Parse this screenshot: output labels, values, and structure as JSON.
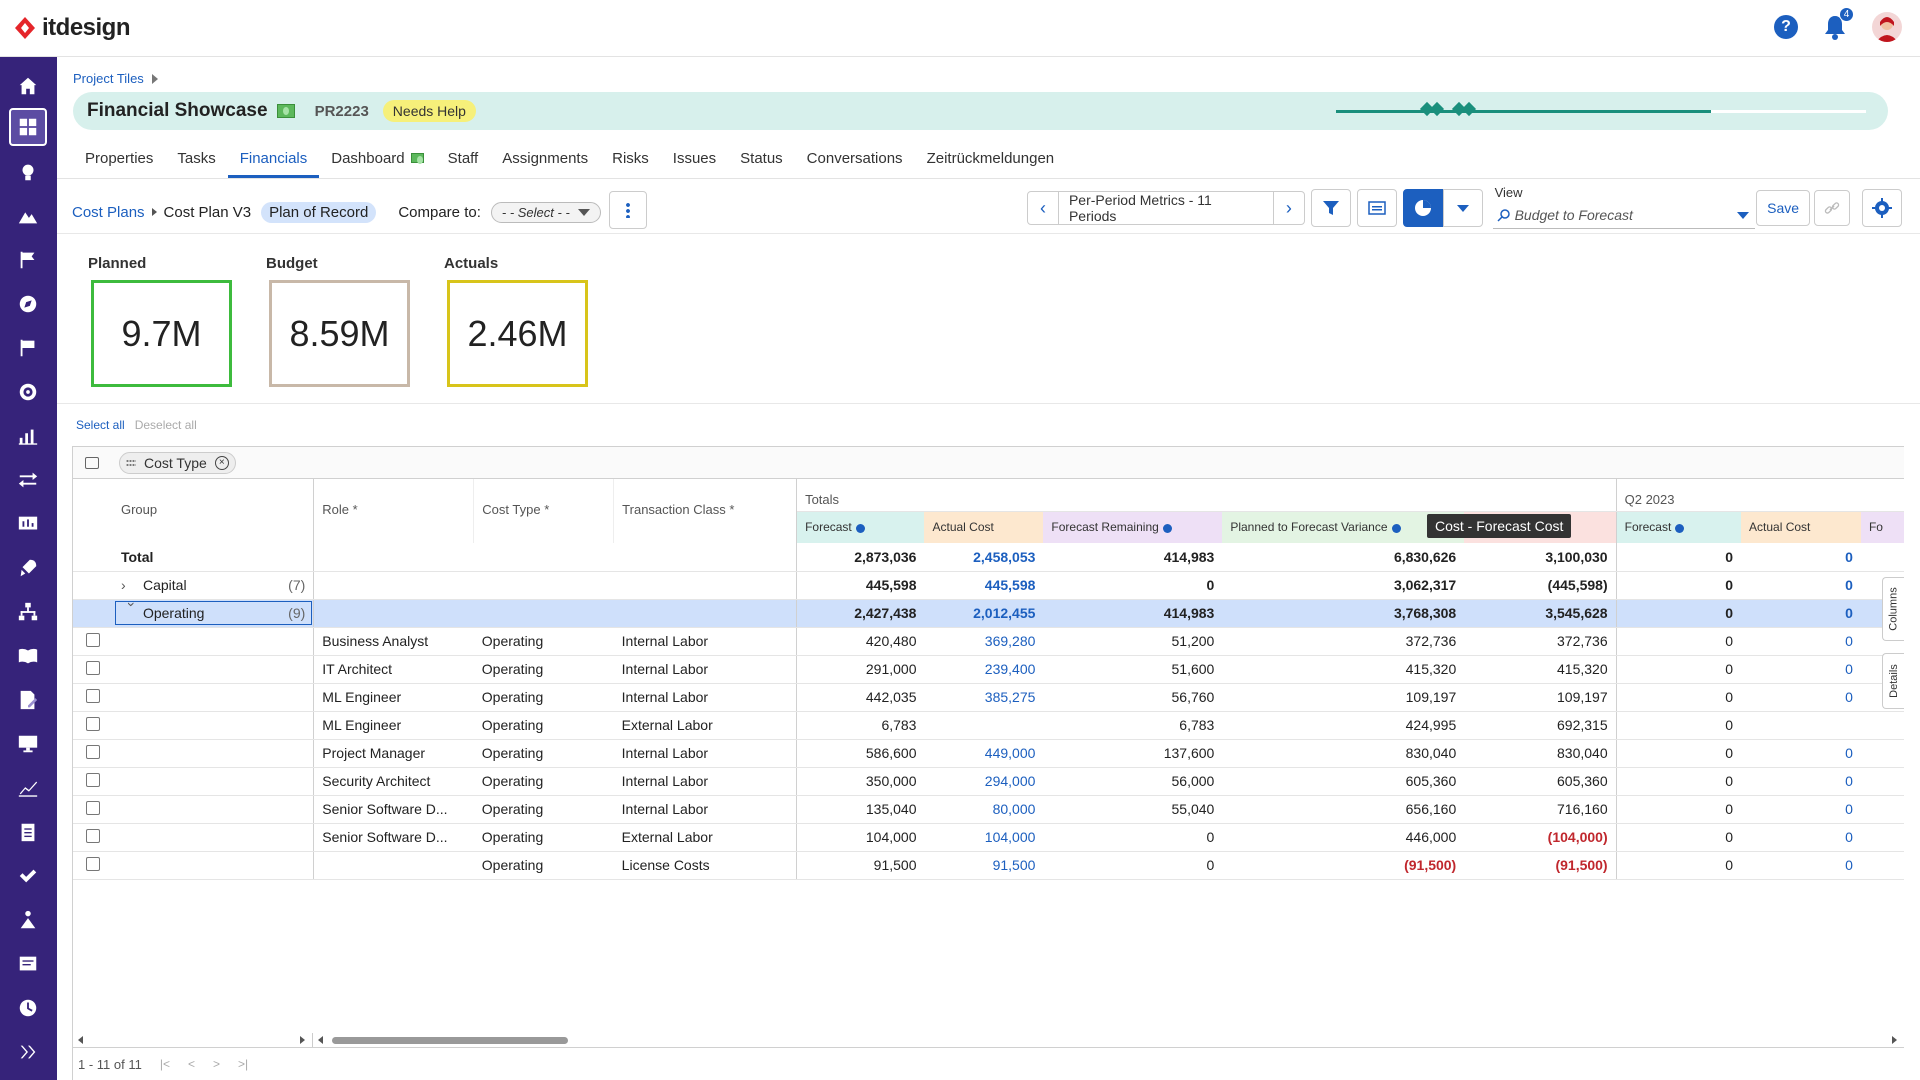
{
  "app": {
    "logo_text": "itdesign",
    "notification_count": "4"
  },
  "breadcrumb": {
    "parent": "Project Tiles"
  },
  "project": {
    "title": "Financial Showcase",
    "code": "PR2223",
    "status": "Needs Help"
  },
  "tabs": [
    "Properties",
    "Tasks",
    "Financials",
    "Dashboard",
    "Staff",
    "Assignments",
    "Risks",
    "Issues",
    "Status",
    "Conversations",
    "Zeitrückmeldungen"
  ],
  "toolbar": {
    "cost_plans": "Cost Plans",
    "cost_plan": "Cost Plan V3",
    "plan_badge": "Plan of Record",
    "compare_label": "Compare to:",
    "compare_placeholder": "- - Select - -",
    "period_label": "Per-Period Metrics - 11 Periods",
    "view_label": "View",
    "view_value": "Budget to Forecast",
    "save_label": "Save"
  },
  "kpis": [
    {
      "label": "Planned",
      "value": "9.7M",
      "color": "#3dbb3d"
    },
    {
      "label": "Budget",
      "value": "8.59M",
      "color": "#c8b8a8"
    },
    {
      "label": "Actuals",
      "value": "2.46M",
      "color": "#d8c41a"
    }
  ],
  "select_all": "Select all",
  "deselect_all": "Deselect all",
  "group_chip": "Cost Type",
  "grid": {
    "headers": {
      "group": "Group",
      "role": "Role",
      "cost_type": "Cost Type",
      "transaction_class": "Transaction Class",
      "totals": "Totals",
      "q2": "Q2 2023",
      "forecast": "Forecast",
      "actual_cost": "Actual Cost",
      "forecast_remaining": "Forecast Remaining",
      "planned_to_forecast_variance": "Planned to Forecast Variance",
      "q2_forecast": "Forecast",
      "q2_actual_cost": "Actual Cost",
      "q2_next": "Fo"
    },
    "tooltip": "Cost - Forecast Cost",
    "total_row": {
      "label": "Total",
      "forecast": "2,873,036",
      "actual": "2,458,053",
      "remaining": "414,983",
      "variance": "6,830,626",
      "cost_var": "3,100,030",
      "q2_forecast": "0",
      "q2_actual": "0"
    },
    "capital_row": {
      "label": "Capital",
      "count": "(7)",
      "forecast": "445,598",
      "actual": "445,598",
      "remaining": "0",
      "variance": "3,062,317",
      "cost_var": "(445,598)",
      "q2_forecast": "0",
      "q2_actual": "0"
    },
    "operating_row": {
      "label": "Operating",
      "count": "(9)",
      "forecast": "2,427,438",
      "actual": "2,012,455",
      "remaining": "414,983",
      "variance": "3,768,308",
      "cost_var": "3,545,628",
      "q2_forecast": "0",
      "q2_actual": "0"
    },
    "rows": [
      {
        "role": "Business Analyst",
        "cost_type": "Operating",
        "tclass": "Internal Labor",
        "forecast": "420,480",
        "actual": "369,280",
        "remaining": "51,200",
        "variance": "372,736",
        "cost_var": "372,736",
        "q2_forecast": "0",
        "q2_actual": "0"
      },
      {
        "role": "IT Architect",
        "cost_type": "Operating",
        "tclass": "Internal Labor",
        "forecast": "291,000",
        "actual": "239,400",
        "remaining": "51,600",
        "variance": "415,320",
        "cost_var": "415,320",
        "q2_forecast": "0",
        "q2_actual": "0"
      },
      {
        "role": "ML Engineer",
        "cost_type": "Operating",
        "tclass": "Internal Labor",
        "forecast": "442,035",
        "actual": "385,275",
        "remaining": "56,760",
        "variance": "109,197",
        "cost_var": "109,197",
        "q2_forecast": "0",
        "q2_actual": "0"
      },
      {
        "role": "ML Engineer",
        "cost_type": "Operating",
        "tclass": "External Labor",
        "forecast": "6,783",
        "actual": "",
        "remaining": "6,783",
        "variance": "424,995",
        "cost_var": "692,315",
        "q2_forecast": "0",
        "q2_actual": ""
      },
      {
        "role": "Project Manager",
        "cost_type": "Operating",
        "tclass": "Internal Labor",
        "forecast": "586,600",
        "actual": "449,000",
        "remaining": "137,600",
        "variance": "830,040",
        "cost_var": "830,040",
        "q2_forecast": "0",
        "q2_actual": "0"
      },
      {
        "role": "Security Architect",
        "cost_type": "Operating",
        "tclass": "Internal Labor",
        "forecast": "350,000",
        "actual": "294,000",
        "remaining": "56,000",
        "variance": "605,360",
        "cost_var": "605,360",
        "q2_forecast": "0",
        "q2_actual": "0"
      },
      {
        "role": "Senior Software D...",
        "cost_type": "Operating",
        "tclass": "Internal Labor",
        "forecast": "135,040",
        "actual": "80,000",
        "remaining": "55,040",
        "variance": "656,160",
        "cost_var": "716,160",
        "q2_forecast": "0",
        "q2_actual": "0"
      },
      {
        "role": "Senior Software D...",
        "cost_type": "Operating",
        "tclass": "External Labor",
        "forecast": "104,000",
        "actual": "104,000",
        "remaining": "0",
        "variance": "446,000",
        "cost_var": "(104,000)",
        "q2_forecast": "0",
        "q2_actual": "0"
      },
      {
        "role": "",
        "cost_type": "Operating",
        "tclass": "License Costs",
        "forecast": "91,500",
        "actual": "91,500",
        "remaining": "0",
        "variance": "(91,500)",
        "cost_var": "(91,500)",
        "q2_forecast": "0",
        "q2_actual": "0"
      }
    ]
  },
  "footer": {
    "range": "1 - 11 of 11"
  },
  "side_tabs": {
    "columns": "Columns",
    "details": "Details"
  },
  "colors": {
    "accent": "#1c5fbf",
    "sidebar": "#36237a",
    "negative": "#c0272d"
  }
}
